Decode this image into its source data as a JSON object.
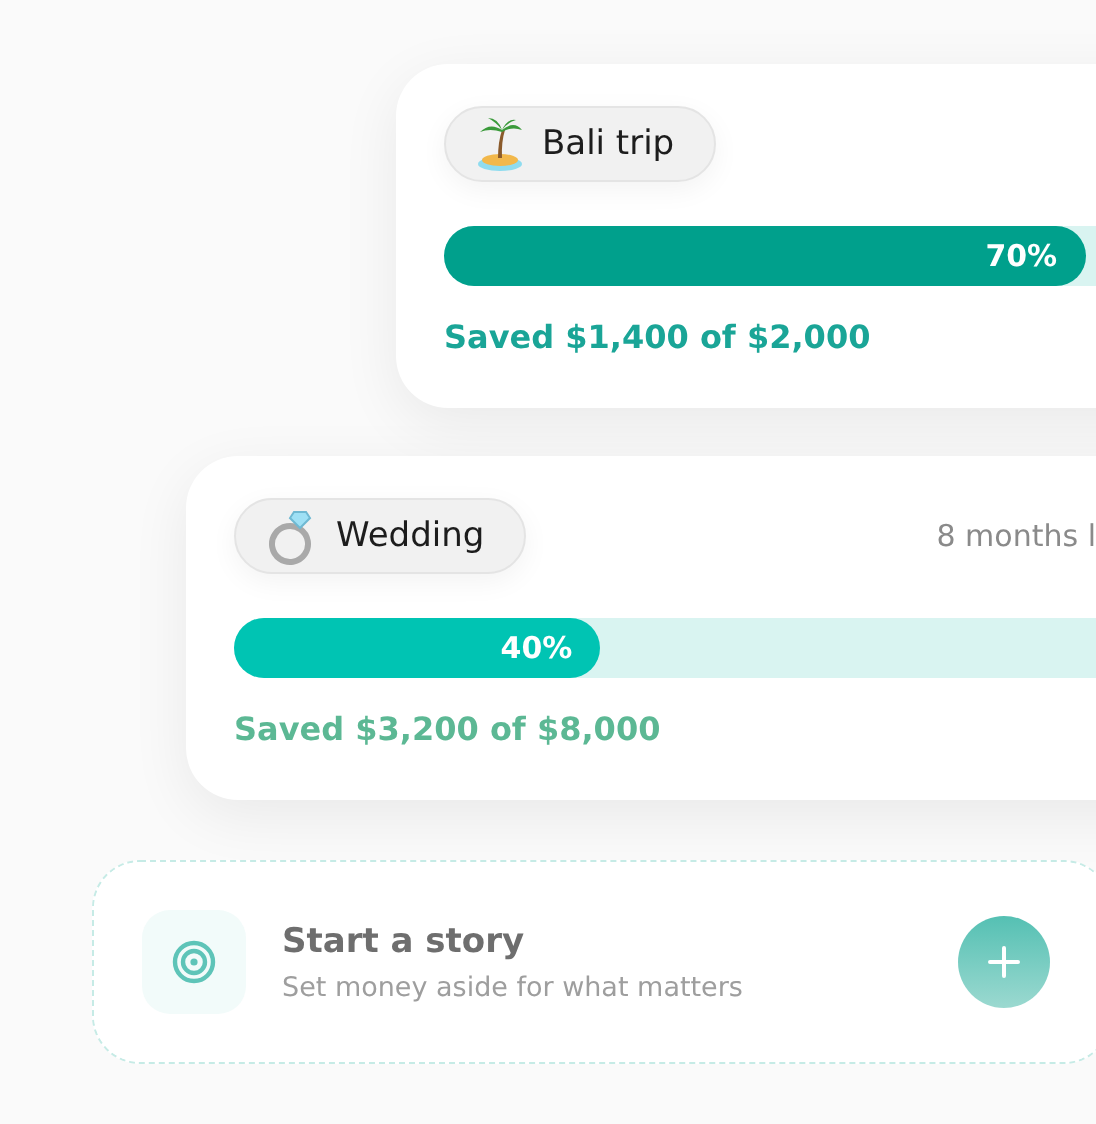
{
  "goals": [
    {
      "kind": "palm",
      "name": "Bali trip",
      "level": 0.7,
      "percent": "70%",
      "saved": "Saved $1,400 of $2,000",
      "color": "#00a08c"
    },
    {
      "kind": "ring",
      "name": "Wedding",
      "time": "8 months l",
      "level": 0.4,
      "percent": "40%",
      "saved": "Saved $3,200 of $8,000",
      "color": "#00c4b3"
    }
  ],
  "new_goal": {
    "title": "Start a story",
    "subtitle": "Set money aside for what matters"
  }
}
